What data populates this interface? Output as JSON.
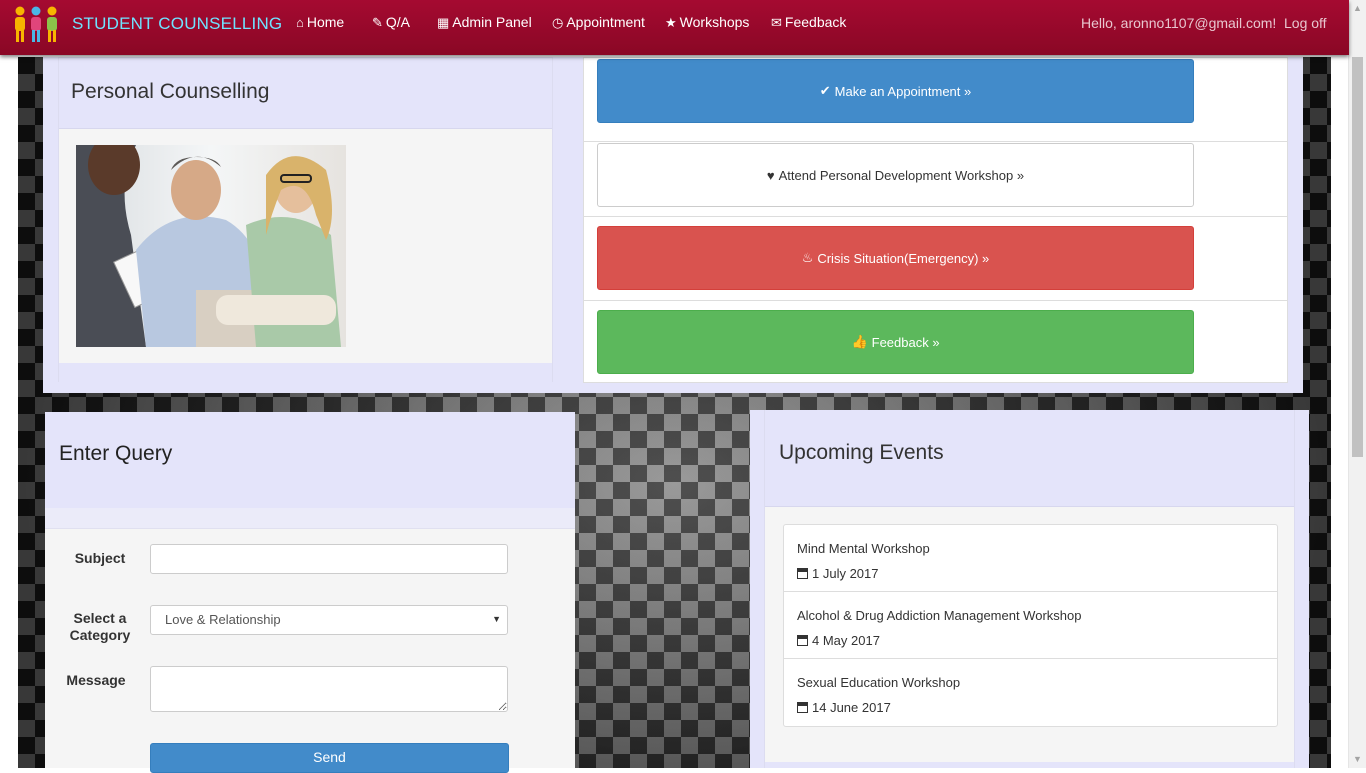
{
  "navbar": {
    "brand": "STUDENT COUNSELLING",
    "items": [
      {
        "label": "Home",
        "icon": "home-icon"
      },
      {
        "label": "Q/A",
        "icon": "edit-icon"
      },
      {
        "label": "Admin Panel",
        "icon": "grid-icon"
      },
      {
        "label": "Appointment",
        "icon": "clock-icon"
      },
      {
        "label": "Workshops",
        "icon": "star-icon"
      },
      {
        "label": "Feedback",
        "icon": "envelope-icon"
      }
    ],
    "greeting": "Hello, aronno1107@gmail.com!",
    "logout": "Log off"
  },
  "personal": {
    "title": "Personal Counselling"
  },
  "actions": [
    {
      "label": "Make an Appointment »",
      "icon": "check-icon",
      "style": "primary"
    },
    {
      "label": "Attend Personal Development Workshop »",
      "icon": "heart-icon",
      "style": "default"
    },
    {
      "label": "Crisis Situation(Emergency) »",
      "icon": "fire-icon",
      "style": "danger"
    },
    {
      "label": "Feedback »",
      "icon": "thumbs-up-icon",
      "style": "success"
    }
  ],
  "query": {
    "title": "Enter Query",
    "subject_label": "Subject",
    "subject_value": "",
    "category_label": "Select a Category",
    "category_value": "Love & Relationship",
    "message_label": "Message",
    "message_value": "",
    "send_label": "Send"
  },
  "events": {
    "title": "Upcoming Events",
    "items": [
      {
        "name": "Mind Mental Workshop",
        "date": "1 July 2017"
      },
      {
        "name": "Alcohol & Drug Addiction Management Workshop",
        "date": "4 May 2017"
      },
      {
        "name": "Sexual Education Workshop",
        "date": "14 June 2017"
      }
    ]
  },
  "colors": {
    "navbar": "#a50a31",
    "brand": "#6fe3ff",
    "panel": "#e4e4fa",
    "primary": "#428bca",
    "danger": "#d9534f",
    "success": "#5cb85c"
  }
}
